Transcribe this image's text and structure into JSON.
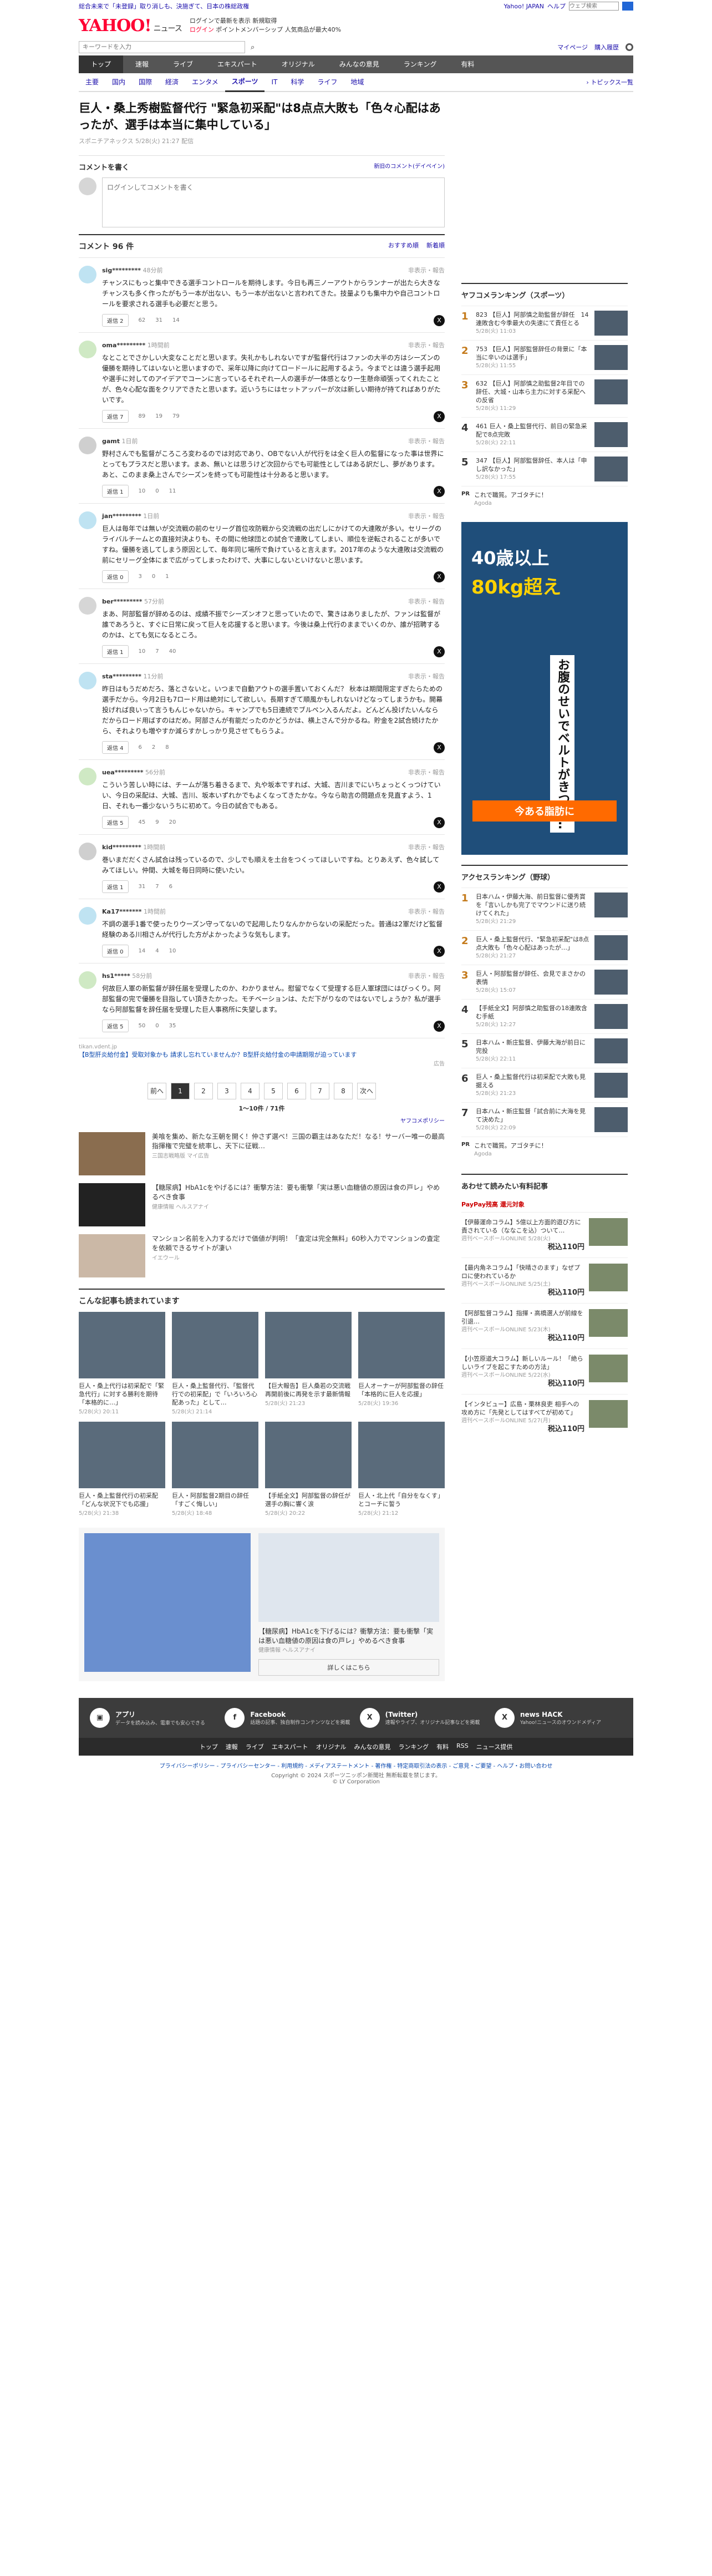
{
  "topbar": {
    "left": "総合未来で「未登録」取り消しも、決施ぎて、日本の株総政権",
    "yahoo_japan": "Yahoo! JAPAN",
    "help": "ヘルプ",
    "search_placeholder": "ウェブ検索"
  },
  "masthead": {
    "logo": "YAHOO!",
    "logo_sub": "ニュース",
    "line1": "ログインで最新を表示 新規取得",
    "login": "ログイン",
    "line2": "ポイントメンバーシップ 人気商品が最大40%"
  },
  "searchbar": {
    "placeholder": "キーワードを入力",
    "mypage": "マイページ",
    "history": "購入履歴"
  },
  "gnav": [
    "トップ",
    "速報",
    "ライブ",
    "エキスパート",
    "オリジナル",
    "みんなの意見",
    "ランキング",
    "有料"
  ],
  "snav": {
    "items": [
      "主要",
      "国内",
      "国際",
      "経済",
      "エンタメ",
      "スポーツ",
      "IT",
      "科学",
      "ライフ",
      "地域"
    ],
    "more": "トピックス一覧"
  },
  "article": {
    "title": "巨人・桑上秀樹監督代行 \"緊急初采配\"は8点点大敗も「色々心配はあったが、選手は本当に集中している」",
    "meta": "スポニチアネックス 5/28(火) 21:27 配信"
  },
  "comment_form": {
    "heading": "コメントを書く",
    "policy": "新旧のコメント(デイペイン)",
    "placeholder": "ログインしてコメントを書く"
  },
  "comments_header": {
    "title": "コメント 96 件",
    "sort1": "おすすめ順",
    "sort2": "新着順"
  },
  "comments": [
    {
      "user": "sig*********",
      "time": "48分前",
      "report": "非表示・報告",
      "text": "チャンスにもっと集中できる選手コントロールを期待します。今日も再三ノーアウトからランナーが出たら大きなチャンスも多く作ったがもう一本が出ない、もう一本が出ないと言われてきた。技量よりも集中力や自己コントロールを要求される選手も必要だと思う。",
      "reply": "返信 2",
      "c1": "62",
      "c2": "31",
      "c3": "14"
    },
    {
      "user": "oma*********",
      "time": "1時間前",
      "report": "非表示・報告",
      "text": "なとことでさかしい大変なことだと思います。失礼かもしれないですが監督代行はファンの大半の方はシーズンの優勝を期待してはいないと思いますので、采年以降に向けてロードールに起用するよう。今までとは違う選手起用や選手に対してのアイデアでコーンに言っているそれぞれ一人の選手が一体感となり一生懸命頑張ってくれたことが、色々心配な面をクリアできたと思います。近いうちにはセットアッパーが次は新しい期待が持てればありがたいです。",
      "reply": "返信 7",
      "c1": "89",
      "c2": "19",
      "c3": "79"
    },
    {
      "user": "gamt",
      "time": "1日前",
      "report": "非表示・報告",
      "text": "野村さんでも監督がころころ変わるのでは対応であり、OBでない人が代行をは全く巨人の監督になった事は世界にとってもプラスだと思います。まあ、無いとは思うけど次回からでも可能性としてはある訳だし、夢があります。あと、このまま桑上さんでシーズンを終っても可能性は十分あると思います。",
      "reply": "返信 1",
      "c1": "10",
      "c2": "0",
      "c3": "11"
    },
    {
      "user": "jan*********",
      "time": "1日前",
      "report": "非表示・報告",
      "text": "巨人は毎年では無いが交流戦の前のセリーグ首位攻防戦から交流戦の出だしにかけての大連敗が多い。セリーグのライバルチームとの直接対決よりも、その間に他球団との試合で連敗してしまい、順位を逆転されることが多いですね。優勝を逃してしまう原因として、毎年同じ場所で負けていると言えます。2017年のような大連敗は交流戦の前にセリーグ全体にまで広がってしまったわけで、大事にしないといけないと思います。",
      "reply": "返信 0",
      "c1": "3",
      "c2": "0",
      "c3": "1"
    },
    {
      "user": "ber*********",
      "time": "57分前",
      "report": "非表示・報告",
      "text": "まあ、阿部監督が辞めるのは、成績不振でシーズンオフと思っていたので、驚きはありましたが、ファンは監督が誰であろうと、すぐに日常に戻って巨人を応援すると思います。今後は桑上代行のままでいくのか、誰が招聘するのかは、とても気になるところ。",
      "reply": "返信 1",
      "c1": "10",
      "c2": "7",
      "c3": "40"
    },
    {
      "user": "sta*********",
      "time": "11分前",
      "report": "非表示・報告",
      "text": "昨日はもうだめだろ、落とさないと。いつまで自動アウトの選手置いておくんだ？ 秋本は期間限定すぎたらための選手だから。今月2日も7ロード用は絶対にして欲しい。長期すぎて順風かもしれないけどなってしまうかも。開幕投げれば良いって言うもんじゃないから。キャンプでも5日連続でブルペン入るんだよ。どんどん投げたいんならだからロード用ばすのはだめ。阿部さんが有能だったのかどうかは、横上さんで分かるね。貯金を2試合続けたから、それよりも増やすか減らすかしっかり見させてもらうよ。",
      "reply": "返信 4",
      "c1": "6",
      "c2": "2",
      "c3": "8"
    },
    {
      "user": "uea*********",
      "time": "56分前",
      "report": "非表示・報告",
      "text": "こういう苦しい時には、チームが落ち着きるまで、丸や坂本ですれば、大城、吉川までにいちょっとくっつけていい、今日の采配は、大城、吉川、坂本いずれかでもよくなってきたかな。今なら助言の問題点を見直すよう、1日、それも一番少ないうちに初めて。今日の試合でもある。",
      "reply": "返信 5",
      "c1": "45",
      "c2": "9",
      "c3": "20"
    },
    {
      "user": "kid*********",
      "time": "1時間前",
      "report": "非表示・報告",
      "text": "巻いまだだくさん試合は残っているので、少しでも順えを土台をつくってほしいですね。とりあえず、色々試してみてほしい。仲間、大城を毎日同時に使いたい。",
      "reply": "返信 1",
      "c1": "31",
      "c2": "7",
      "c3": "6"
    },
    {
      "user": "Ka17*******",
      "time": "1時間前",
      "report": "非表示・報告",
      "text": "不調の選手1番で使ったりウーズン守ってないので起用したりなんかからないの采配だった。普通は2軍だけど監督経験のある川相さんが代行した方がよかったような気もします。",
      "reply": "返信 0",
      "c1": "14",
      "c2": "4",
      "c3": "10"
    },
    {
      "user": "hs1*****",
      "time": "58分前",
      "report": "非表示・報告",
      "text": "何故巨人軍の新監督が辞任届を受理したのか、わかりません。慰留でなくて受理する巨人軍球団にはびっくり。阿部監督の完で優勝を目指してい頂きたかった。モチベーションは、ただ下がりなのではないでしょうか？私が選手なら阿部監督を辞任届を受理した巨人事務所に失望します。",
      "reply": "返信 5",
      "c1": "50",
      "c2": "0",
      "c3": "35"
    }
  ],
  "comment_ad": {
    "sp": "tikan.vdent.jp",
    "text": "【B型肝炎給付金】受取対象かも 請求し忘れていませんか？B型肝炎給付金の申請期限が迫っています",
    "pr": "広告"
  },
  "pager": {
    "prev": "前へ",
    "pages": [
      "1",
      "2",
      "3",
      "4",
      "5",
      "6",
      "7",
      "8"
    ],
    "next": "次へ",
    "count": "1〜10件 / 71件",
    "policy": "ヤフコメポリシー"
  },
  "promos": [
    {
      "text": "美喰を集め、新たな王朝を開く！仲さず選べ！三国の覇主はあなただ！なる！サーバー唯一の最高指揮権で完璧を統率し、天下に征戦…",
      "sp": "三国志戦略版 マイ広告"
    },
    {
      "text": "【糖尿病】HbA1cをやげるには？衝撃方法：要も衝撃「実は悪い血糖値の原因は食の戸レ」やめるべき食事",
      "sp": "健康情報 ヘルスアナイ"
    },
    {
      "text": "マンション名前を入力するだけで価値が判明！「査定は完全無料」60秒入力でマンションの査定を依頼できるサイトが凄い",
      "sp": "イエウール"
    }
  ],
  "related": {
    "title": "こんな記事も読まれています",
    "items": [
      {
        "t": "巨人・桑上代行は初采配で「緊急代行」に対する勝利を期待「本格的に…」",
        "time": "5/28(火) 20:11"
      },
      {
        "t": "巨人・桑上監督代行、「監督代行での初采配」で「いろいろ心配あった」として…",
        "time": "5/28(火) 21:14"
      },
      {
        "t": "【巨大報告】巨人桑若の交流戦再開前後に再発を示す最新情報",
        "time": "5/28(火) 21:23"
      },
      {
        "t": "巨人オーナーが阿部監督の辞任「本格的に巨人を応援」",
        "time": "5/28(火) 19:36"
      },
      {
        "t": "巨人・桑上監督代行の初采配「どんな状況下でも応援」",
        "time": "5/28(火) 21:38"
      },
      {
        "t": "巨人・阿部監督2期目の辞任「すごく悔しい」",
        "time": "5/28(火) 18:48"
      },
      {
        "t": "【手紙全文】阿部監督の辞任が選手の胸に響く涙",
        "time": "5/28(火) 20:22"
      },
      {
        "t": "巨人・北上代「自分をなくす」とコーチに誓う",
        "time": "5/28(火) 21:12"
      }
    ]
  },
  "bigad": {
    "text": "【糖尿病】HbA1cを下げるには？衝撃方法：要も衝撃「実は悪い血糖値の原因は食の戸レ」やめるべき食事",
    "sp": "健康情報 ヘルスアナイ",
    "more": "詳しくはこちら"
  },
  "side_rank": {
    "title": "ヤフコメランキング（スポーツ）",
    "items": [
      {
        "n": "1",
        "c": "823",
        "t": "【巨人】阿部慎之助監督が辞任　14連敗含む今季最大の失速にて責任とる",
        "time": "5/28(火) 11:03"
      },
      {
        "n": "2",
        "c": "753",
        "t": "【巨人】阿部監督辞任の背景に「本当に辛いのは選手」",
        "time": "5/28(火) 11:55"
      },
      {
        "n": "3",
        "c": "632",
        "t": "【巨人】阿部慎之助監督2年目での辞任、大城・山本ら主力に対する采配への反省",
        "time": "5/28(火) 11:29"
      },
      {
        "n": "4",
        "c": "461",
        "t": "巨人・桑上監督代行、前日の緊急采配で8点完敗",
        "time": "5/28(火) 22:11"
      },
      {
        "n": "5",
        "c": "347",
        "t": "【巨人】阿部監督辞任、本人は「申し訳なかった」",
        "time": "5/28(火) 17:55"
      }
    ],
    "pr": "これで職質。アゴタチに！",
    "pr_sp": "Agoda"
  },
  "side_ad": {
    "a1": "40歳以上",
    "a2": "80kg超え",
    "a3": "お腹のせいでベルトがきつい…",
    "a4": "今ある脂肪に"
  },
  "access_rank": {
    "title": "アクセスランキング（野球）",
    "items": [
      {
        "n": "1",
        "t": "日本ハム・伊藤大海、前日監督に優秀賞を「言いしかも完了でマウンドに送り続けてくれた」",
        "time": "5/28(火) 21:29"
      },
      {
        "n": "2",
        "t": "巨人・桑上監督代行、\"緊急初采配\"は8点点大敗も「色々心配はあったが…」",
        "time": "5/28(火) 21:27"
      },
      {
        "n": "3",
        "t": "巨人・阿部監督が辞任、会見でまさかの表情",
        "time": "5/28(火) 15:07"
      },
      {
        "n": "4",
        "t": "【手紙全文】阿部慎之助監督の18連敗含む手紙",
        "time": "5/28(火) 12:27"
      },
      {
        "n": "5",
        "t": "日本ハム・新庄監督、伊藤大海が前日に完投",
        "time": "5/28(火) 22:11"
      },
      {
        "n": "6",
        "t": "巨人・桑上監督代行は初采配で大敗も見据える",
        "time": "5/28(火) 21:23"
      },
      {
        "n": "7",
        "t": "日本ハム・新庄監督「試合前に大海を見て決めた」",
        "time": "5/28(火) 22:09"
      }
    ],
    "pr": "これで職質。アゴタチに！",
    "pr_sp": "Agoda"
  },
  "kaiten": {
    "title": "あわせて読みたい有料記事",
    "paypay": "PayPay残高 還元対象",
    "items": [
      {
        "t": "【伊藤運命コラム】5億以上方面的遊び方に責されている（ななこを込）ついて…",
        "sp": "週刊ベースボールONLINE 5/28(火)",
        "p": "税込110円"
      },
      {
        "t": "【最内角ネコラム】「快晴さのます」なぜプロに使われているか",
        "sp": "週刊ベースボールONLINE 5/25(土)",
        "p": "税込110円"
      },
      {
        "t": "【阿部監督コラム】指揮・高橋選人が前線を引退…",
        "sp": "週刊ベースボールONLINE 5/23(木)",
        "p": "税込110円"
      },
      {
        "t": "【小笠原道大コラム】新しいルール！「絶らしいライブを起こすための方法」",
        "sp": "週刊ベースボールONLINE 5/22(水)",
        "p": "税込110円"
      },
      {
        "t": "【インタビュー】広島・栗林良吏 相手への攻め方に「先発としてはすべてが初めて」",
        "sp": "週刊ベースボールONLINE 5/27(月)",
        "p": "税込110円"
      }
    ]
  },
  "footer": {
    "social": [
      {
        "icon": "▣",
        "t": "アプリ",
        "d": "データを読み込み、電車でも安心できる"
      },
      {
        "icon": "f",
        "t": "Facebook",
        "d": "話題の記事、独自制作コンテンツなどを掲載"
      },
      {
        "icon": "X",
        "t": "(Twitter)",
        "d": "速報やライブ、オリジナル記事などを掲載"
      },
      {
        "icon": "X",
        "t": "news HACK",
        "d": "Yahoo!ニュースのオウンドメディア"
      }
    ],
    "nav": [
      "トップ",
      "速報",
      "ライブ",
      "エキスパート",
      "オリジナル",
      "みんなの意見",
      "ランキング",
      "有料",
      "RSS",
      "ニュース提供"
    ],
    "legal": "プライバシーポリシー - プライバシーセンター - 利用規約 - メディアステートメント - 著作権 - 特定商取引法の表示 - ご意見・ご要望 - ヘルプ・お問い合わせ",
    "copy": "Copyright © 2024 スポーツニッポン新聞社 無断転載を禁じます。",
    "copy2": "© LY Corporation"
  }
}
